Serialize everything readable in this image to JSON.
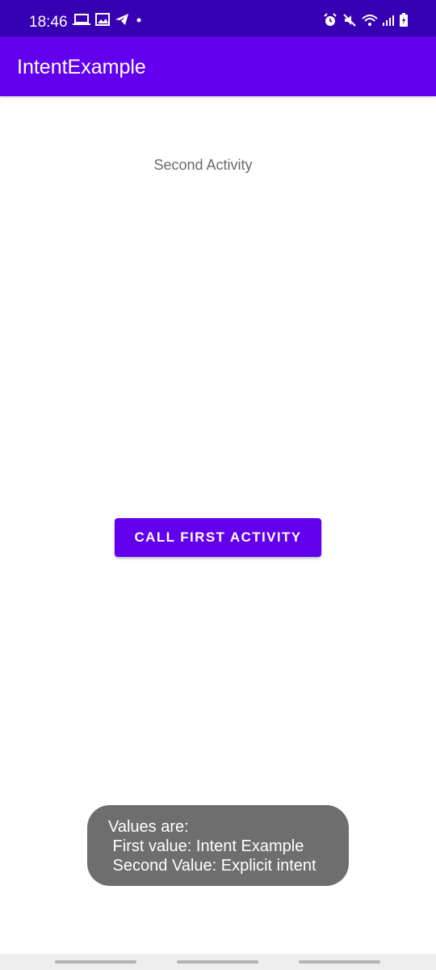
{
  "status_bar": {
    "time": "18:46",
    "left_icons": [
      "laptop-icon",
      "image-icon",
      "telegram-icon",
      "dot-icon"
    ],
    "right_icons": [
      "alarm-icon",
      "mute-icon",
      "wifi-icon",
      "signal-icon",
      "battery-icon"
    ],
    "background_color": "#3700b3"
  },
  "app_bar": {
    "title": "IntentExample",
    "background_color": "#6200ee"
  },
  "main": {
    "activity_label": "Second Activity",
    "button_label": "CALL FIRST ACTIVITY"
  },
  "toast": {
    "line1": "Values are:",
    "line2": " First value: Intent Example",
    "line3": " Second Value: Explicit intent"
  },
  "nav_bar": {
    "handles": [
      "recent-apps",
      "home",
      "back"
    ]
  }
}
